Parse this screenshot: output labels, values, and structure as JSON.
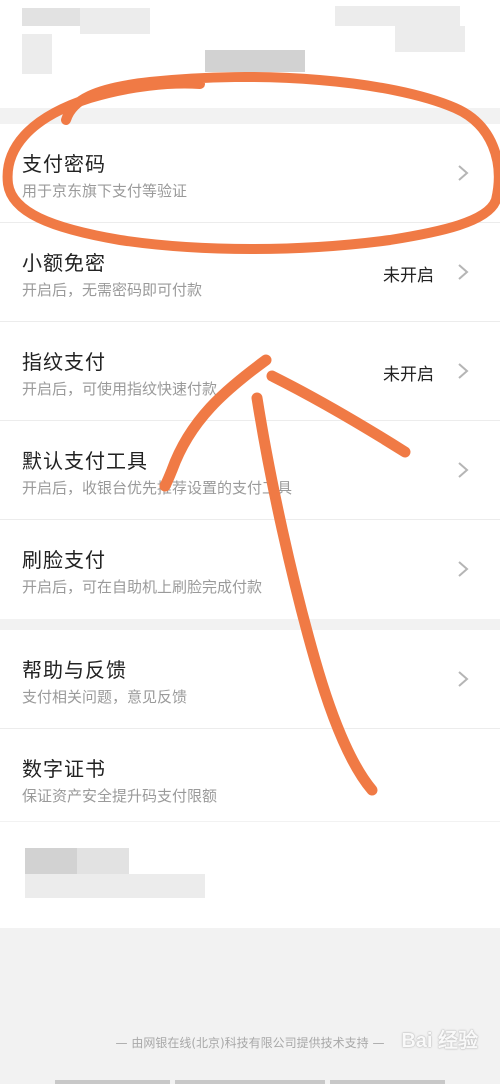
{
  "settings_group_1": [
    {
      "title": "支付密码",
      "subtitle": "用于京东旗下支付等验证",
      "status": ""
    },
    {
      "title": "小额免密",
      "subtitle": "开启后，无需密码即可付款",
      "status": "未开启"
    },
    {
      "title": "指纹支付",
      "subtitle": "开启后，可使用指纹快速付款",
      "status": "未开启"
    },
    {
      "title": "默认支付工具",
      "subtitle": "开启后，收银台优先推荐设置的支付工具",
      "status": ""
    },
    {
      "title": "刷脸支付",
      "subtitle": "开启后，可在自助机上刷脸完成付款",
      "status": ""
    }
  ],
  "settings_group_2": [
    {
      "title": "帮助与反馈",
      "subtitle": "支付相关问题，意见反馈",
      "status": ""
    },
    {
      "title": "数字证书",
      "subtitle": "保证资产安全提升码支付限额",
      "status": ""
    }
  ],
  "footer": {
    "text": "— 由网银在线(北京)科技有限公司提供技术支持 —"
  },
  "watermark": {
    "text": "Bai 经验"
  },
  "colors": {
    "annotation_stroke": "#f07a45",
    "chevron": "#b5b5b5"
  },
  "icons": {
    "row_arrow": "chevron-right-icon"
  }
}
